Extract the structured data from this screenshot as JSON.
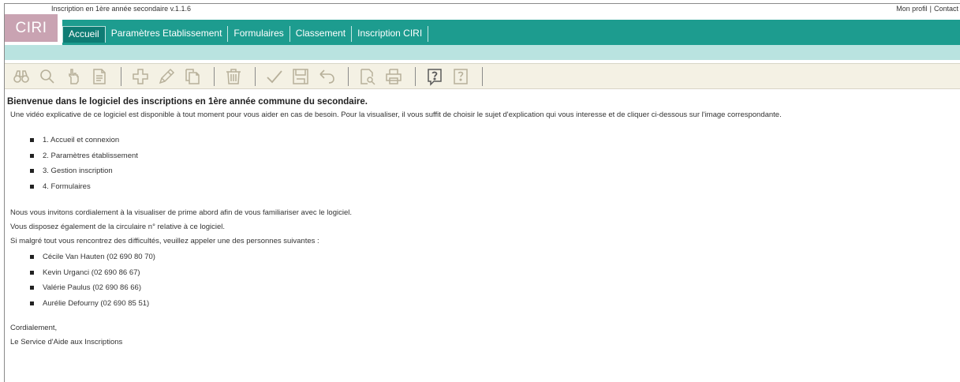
{
  "app": {
    "logo": "CIRI",
    "version": "Inscription en 1ère année secondaire v.1.1.6"
  },
  "top_links": {
    "profile": "Mon profil",
    "separator": "|",
    "contact": "Contact"
  },
  "nav": {
    "items": [
      {
        "label": "Accueil",
        "active": true
      },
      {
        "label": "Paramètres Etablissement",
        "active": false
      },
      {
        "label": "Formulaires",
        "active": false
      },
      {
        "label": "Classement",
        "active": false
      },
      {
        "label": "Inscription CIRI",
        "active": false
      }
    ]
  },
  "toolbar": {
    "groups": [
      [
        "binoculars-icon",
        "magnifier-icon",
        "hand-pointer-icon",
        "document-icon"
      ],
      [
        "add-icon",
        "pencil-icon",
        "copy-icon"
      ],
      [
        "trash-icon"
      ],
      [
        "checkmark-icon",
        "save-icon",
        "undo-icon"
      ],
      [
        "print-preview-icon",
        "printer-icon"
      ],
      [
        "help-icon",
        "context-help-icon"
      ]
    ]
  },
  "main": {
    "title": "Bienvenue dans le logiciel des inscriptions en 1ère année commune du secondaire.",
    "intro": "Une vidéo explicative de ce logiciel est disponible à tout moment pour vous aider en cas de besoin. Pour la visualiser, il vous suffit de choisir le sujet d'explication qui vous interesse et de cliquer ci-dessous sur l'image correspondante.",
    "videos": [
      "1. Accueil et connexion",
      "2. Paramètres établissement",
      "3. Gestion inscription",
      "4. Formulaires"
    ],
    "invite": "Nous vous invitons cordialement à la visualiser de prime abord afin de vous familiariser avec le logiciel.",
    "circulaire": "Vous disposez également de la circulaire n° relative à ce logiciel.",
    "contact_intro": "Si malgré tout vous rencontrez des difficultés, veuillez appeler une des personnes suivantes :",
    "contacts": [
      "Cécile Van Hauten (02 690 80 70)",
      "Kevin Urganci (02 690 86 67)",
      "Valérie Paulus (02 690 86 66)",
      "Aurélie Defourny (02 690 85 51)"
    ],
    "closing": "Cordialement,",
    "signature": "Le Service d'Aide aux Inscriptions"
  },
  "colors": {
    "nav_bg": "#1d9c8f",
    "nav_active": "#0f7c74",
    "band": "#b9e3e0",
    "logo_bg": "#c9a3b2",
    "toolbar_bg": "#f4f1e4"
  }
}
